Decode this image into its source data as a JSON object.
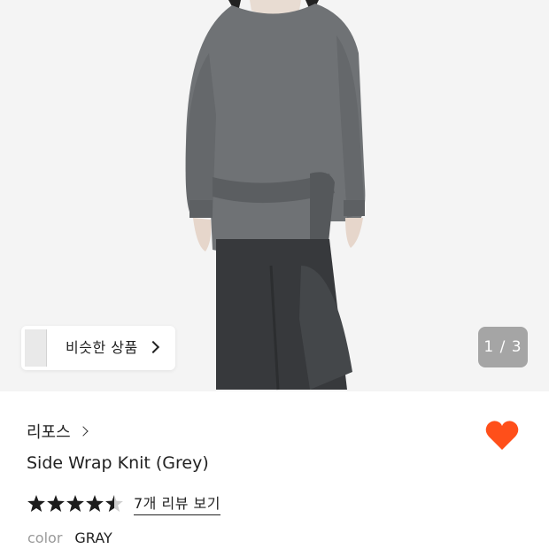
{
  "gallery": {
    "similar_products_label": "비슷한 상품",
    "counter_text": "1 / 3"
  },
  "product": {
    "brand": "리포스",
    "title": "Side Wrap Knit (Grey)",
    "rating": 4.5,
    "review_link": "7개 리뷰 보기",
    "color_label": "color",
    "color_value": "GRAY",
    "liked": true
  },
  "colors": {
    "heart": "#ff4f1a",
    "star": "#1c1c1c",
    "star_empty": "#cfcfcf"
  },
  "icons": [
    "chevron-right-icon",
    "heart-icon",
    "star-icon",
    "half-star-icon",
    "stacked-thumbnails-icon"
  ]
}
